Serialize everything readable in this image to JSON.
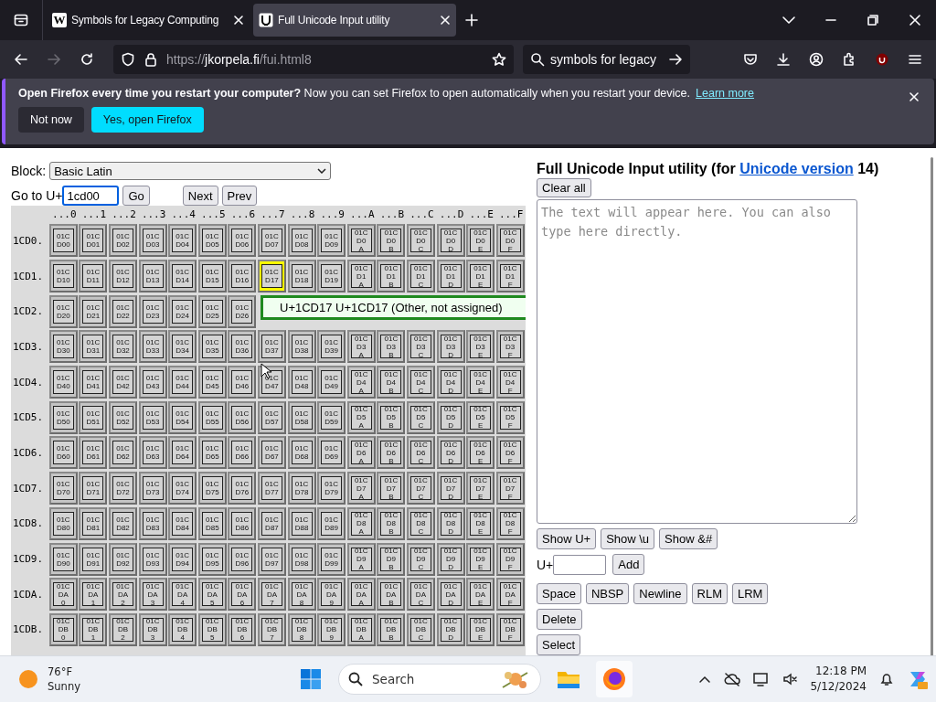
{
  "browser": {
    "tabs": [
      {
        "favicon": "W",
        "title": "Symbols for Legacy Computing",
        "selected": false
      },
      {
        "title": "Full Unicode Input utility",
        "selected": true
      }
    ],
    "address": {
      "scheme": "https://",
      "host": "jkorpela.fi",
      "path": "/fui.html8"
    },
    "search": {
      "value": "symbols for legacy"
    },
    "notification": {
      "message": "**Open Firefox every time you restart your computer?** Now you can set Firefox to open automatically when you restart your device.",
      "link": "Learn more",
      "buttons": [
        "Not now",
        "Yes, open Firefox"
      ]
    }
  },
  "page": {
    "block": {
      "label": "Block:",
      "value": "Basic Latin"
    },
    "goto": {
      "label": "Go to U+",
      "value": "1cd00",
      "go": "Go",
      "nav": [
        "Next",
        "Prev"
      ]
    },
    "grid": {
      "columns": [
        "...0",
        "...1",
        "...2",
        "...3",
        "...4",
        "...5",
        "...6",
        "...7",
        "...8",
        "...9",
        "...A",
        "...B",
        "...C",
        "...D",
        "...E",
        "...F"
      ],
      "rows": [
        {
          "label": "1CD0.",
          "cells": [
            {
              "code": "01CD00",
              "selected": false
            },
            {
              "code": "01CD01",
              "selected": false
            },
            {
              "code": "01CD02",
              "selected": false
            },
            {
              "code": "01CD03",
              "selected": false
            },
            {
              "code": "01CD04",
              "selected": false
            },
            {
              "code": "01CD05",
              "selected": false
            },
            {
              "code": "01CD06",
              "selected": false
            },
            {
              "code": "01CD07",
              "selected": false
            },
            {
              "code": "01CD08",
              "selected": false
            },
            {
              "code": "01CD09",
              "selected": false
            },
            {
              "code": "01CD0A",
              "selected": false
            },
            {
              "code": "01CD0B",
              "selected": false
            },
            {
              "code": "01CD0C",
              "selected": false
            },
            {
              "code": "01CD0D",
              "selected": false
            },
            {
              "code": "01CD0E",
              "selected": false
            },
            {
              "code": "01CD0F",
              "selected": false
            }
          ]
        },
        {
          "label": "1CD1.",
          "cells": [
            {
              "code": "01CD10",
              "selected": false
            },
            {
              "code": "01CD11",
              "selected": false
            },
            {
              "code": "01CD12",
              "selected": false
            },
            {
              "code": "01CD13",
              "selected": false
            },
            {
              "code": "01CD14",
              "selected": false
            },
            {
              "code": "01CD15",
              "selected": false
            },
            {
              "code": "01CD16",
              "selected": false
            },
            {
              "code": "01CD17",
              "selected": true
            },
            {
              "code": "01CD18",
              "selected": false
            },
            {
              "code": "01CD19",
              "selected": false
            },
            {
              "code": "01CD1A",
              "selected": false
            },
            {
              "code": "01CD1B",
              "selected": false
            },
            {
              "code": "01CD1C",
              "selected": false
            },
            {
              "code": "01CD1D",
              "selected": false
            },
            {
              "code": "01CD1E",
              "selected": false
            },
            {
              "code": "01CD1F",
              "selected": false
            }
          ]
        },
        {
          "label": "1CD2.",
          "cells": [
            {
              "code": "01CD20",
              "selected": false
            },
            {
              "code": "01CD21",
              "selected": false
            },
            {
              "code": "01CD22",
              "selected": false
            },
            {
              "code": "01CD23",
              "selected": false
            },
            {
              "code": "01CD24",
              "selected": false
            },
            {
              "code": "01CD25",
              "selected": false
            },
            {
              "code": "01CD26",
              "selected": false
            }
          ]
        },
        {
          "label": "1CD3.",
          "cells": [
            {
              "code": "01CD30",
              "selected": false
            },
            {
              "code": "01CD31",
              "selected": false
            },
            {
              "code": "01CD32",
              "selected": false
            },
            {
              "code": "01CD33",
              "selected": false
            },
            {
              "code": "01CD34",
              "selected": false
            },
            {
              "code": "01CD35",
              "selected": false
            },
            {
              "code": "01CD36",
              "selected": false
            },
            {
              "code": "01CD37",
              "selected": false
            },
            {
              "code": "01CD38",
              "selected": false
            },
            {
              "code": "01CD39",
              "selected": false
            },
            {
              "code": "01CD3A",
              "selected": false
            },
            {
              "code": "01CD3B",
              "selected": false
            },
            {
              "code": "01CD3C",
              "selected": false
            },
            {
              "code": "01CD3D",
              "selected": false
            },
            {
              "code": "01CD3E",
              "selected": false
            },
            {
              "code": "01CD3F",
              "selected": false
            }
          ]
        },
        {
          "label": "1CD4.",
          "cells": [
            {
              "code": "01CD40",
              "selected": false
            },
            {
              "code": "01CD41",
              "selected": false
            },
            {
              "code": "01CD42",
              "selected": false
            },
            {
              "code": "01CD43",
              "selected": false
            },
            {
              "code": "01CD44",
              "selected": false
            },
            {
              "code": "01CD45",
              "selected": false
            },
            {
              "code": "01CD46",
              "selected": false
            },
            {
              "code": "01CD47",
              "selected": false
            },
            {
              "code": "01CD48",
              "selected": false
            },
            {
              "code": "01CD49",
              "selected": false
            },
            {
              "code": "01CD4A",
              "selected": false
            },
            {
              "code": "01CD4B",
              "selected": false
            },
            {
              "code": "01CD4C",
              "selected": false
            },
            {
              "code": "01CD4D",
              "selected": false
            },
            {
              "code": "01CD4E",
              "selected": false
            },
            {
              "code": "01CD4F",
              "selected": false
            }
          ]
        },
        {
          "label": "1CD5.",
          "cells": [
            {
              "code": "01CD50",
              "selected": false
            },
            {
              "code": "01CD51",
              "selected": false
            },
            {
              "code": "01CD52",
              "selected": false
            },
            {
              "code": "01CD53",
              "selected": false
            },
            {
              "code": "01CD54",
              "selected": false
            },
            {
              "code": "01CD55",
              "selected": false
            },
            {
              "code": "01CD56",
              "selected": false
            },
            {
              "code": "01CD57",
              "selected": false
            },
            {
              "code": "01CD58",
              "selected": false
            },
            {
              "code": "01CD59",
              "selected": false
            },
            {
              "code": "01CD5A",
              "selected": false
            },
            {
              "code": "01CD5B",
              "selected": false
            },
            {
              "code": "01CD5C",
              "selected": false
            },
            {
              "code": "01CD5D",
              "selected": false
            },
            {
              "code": "01CD5E",
              "selected": false
            },
            {
              "code": "01CD5F",
              "selected": false
            }
          ]
        },
        {
          "label": "1CD6.",
          "cells": [
            {
              "code": "01CD60",
              "selected": false
            },
            {
              "code": "01CD61",
              "selected": false
            },
            {
              "code": "01CD62",
              "selected": false
            },
            {
              "code": "01CD63",
              "selected": false
            },
            {
              "code": "01CD64",
              "selected": false
            },
            {
              "code": "01CD65",
              "selected": false
            },
            {
              "code": "01CD66",
              "selected": false
            },
            {
              "code": "01CD67",
              "selected": false
            },
            {
              "code": "01CD68",
              "selected": false
            },
            {
              "code": "01CD69",
              "selected": false
            },
            {
              "code": "01CD6A",
              "selected": false
            },
            {
              "code": "01CD6B",
              "selected": false
            },
            {
              "code": "01CD6C",
              "selected": false
            },
            {
              "code": "01CD6D",
              "selected": false
            },
            {
              "code": "01CD6E",
              "selected": false
            },
            {
              "code": "01CD6F",
              "selected": false
            }
          ]
        },
        {
          "label": "1CD7.",
          "cells": [
            {
              "code": "01CD70",
              "selected": false
            },
            {
              "code": "01CD71",
              "selected": false
            },
            {
              "code": "01CD72",
              "selected": false
            },
            {
              "code": "01CD73",
              "selected": false
            },
            {
              "code": "01CD74",
              "selected": false
            },
            {
              "code": "01CD75",
              "selected": false
            },
            {
              "code": "01CD76",
              "selected": false
            },
            {
              "code": "01CD77",
              "selected": false
            },
            {
              "code": "01CD78",
              "selected": false
            },
            {
              "code": "01CD79",
              "selected": false
            },
            {
              "code": "01CD7A",
              "selected": false
            },
            {
              "code": "01CD7B",
              "selected": false
            },
            {
              "code": "01CD7C",
              "selected": false
            },
            {
              "code": "01CD7D",
              "selected": false
            },
            {
              "code": "01CD7E",
              "selected": false
            },
            {
              "code": "01CD7F",
              "selected": false
            }
          ]
        },
        {
          "label": "1CD8.",
          "cells": [
            {
              "code": "01CD80",
              "selected": false
            },
            {
              "code": "01CD81",
              "selected": false
            },
            {
              "code": "01CD82",
              "selected": false
            },
            {
              "code": "01CD83",
              "selected": false
            },
            {
              "code": "01CD84",
              "selected": false
            },
            {
              "code": "01CD85",
              "selected": false
            },
            {
              "code": "01CD86",
              "selected": false
            },
            {
              "code": "01CD87",
              "selected": false
            },
            {
              "code": "01CD88",
              "selected": false
            },
            {
              "code": "01CD89",
              "selected": false
            },
            {
              "code": "01CD8A",
              "selected": false
            },
            {
              "code": "01CD8B",
              "selected": false
            },
            {
              "code": "01CD8C",
              "selected": false
            },
            {
              "code": "01CD8D",
              "selected": false
            },
            {
              "code": "01CD8E",
              "selected": false
            },
            {
              "code": "01CD8F",
              "selected": false
            }
          ]
        },
        {
          "label": "1CD9.",
          "cells": [
            {
              "code": "01CD90",
              "selected": false
            },
            {
              "code": "01CD91",
              "selected": false
            },
            {
              "code": "01CD92",
              "selected": false
            },
            {
              "code": "01CD93",
              "selected": false
            },
            {
              "code": "01CD94",
              "selected": false
            },
            {
              "code": "01CD95",
              "selected": false
            },
            {
              "code": "01CD96",
              "selected": false
            },
            {
              "code": "01CD97",
              "selected": false
            },
            {
              "code": "01CD98",
              "selected": false
            },
            {
              "code": "01CD99",
              "selected": false
            },
            {
              "code": "01CD9A",
              "selected": false
            },
            {
              "code": "01CD9B",
              "selected": false
            },
            {
              "code": "01CD9C",
              "selected": false
            },
            {
              "code": "01CD9D",
              "selected": false
            },
            {
              "code": "01CD9E",
              "selected": false
            },
            {
              "code": "01CD9F",
              "selected": false
            }
          ]
        },
        {
          "label": "1CDA.",
          "cells": [
            {
              "code": "01CDA0",
              "selected": false
            },
            {
              "code": "01CDA1",
              "selected": false
            },
            {
              "code": "01CDA2",
              "selected": false
            },
            {
              "code": "01CDA3",
              "selected": false
            },
            {
              "code": "01CDA4",
              "selected": false
            },
            {
              "code": "01CDA5",
              "selected": false
            },
            {
              "code": "01CDA6",
              "selected": false
            },
            {
              "code": "01CDA7",
              "selected": false
            },
            {
              "code": "01CDA8",
              "selected": false
            },
            {
              "code": "01CDA9",
              "selected": false
            },
            {
              "code": "01CDAA",
              "selected": false
            },
            {
              "code": "01CDAB",
              "selected": false
            },
            {
              "code": "01CDAC",
              "selected": false
            },
            {
              "code": "01CDAD",
              "selected": false
            },
            {
              "code": "01CDAE",
              "selected": false
            },
            {
              "code": "01CDAF",
              "selected": false
            }
          ]
        },
        {
          "label": "1CDB.",
          "cells": [
            {
              "code": "01CDB0",
              "selected": false
            },
            {
              "code": "01CDB1",
              "selected": false
            },
            {
              "code": "01CDB2",
              "selected": false
            },
            {
              "code": "01CDB3",
              "selected": false
            },
            {
              "code": "01CDB4",
              "selected": false
            },
            {
              "code": "01CDB5",
              "selected": false
            },
            {
              "code": "01CDB6",
              "selected": false
            },
            {
              "code": "01CDB7",
              "selected": false
            },
            {
              "code": "01CDB8",
              "selected": false
            },
            {
              "code": "01CDB9",
              "selected": false
            },
            {
              "code": "01CDBA",
              "selected": false
            },
            {
              "code": "01CDBB",
              "selected": false
            },
            {
              "code": "01CDBC",
              "selected": false
            },
            {
              "code": "01CDBD",
              "selected": false
            },
            {
              "code": "01CDBE",
              "selected": false
            },
            {
              "code": "01CDBF",
              "selected": false
            }
          ]
        }
      ]
    },
    "tooltip": "U+1CD17 U+1CD17 (Other, not assigned)",
    "title": {
      "before": "Full Unicode Input utility (for ",
      "link": "Unicode version",
      "after": " 14)"
    },
    "clear": "Clear all",
    "textarea": {
      "placeholder": "The text will appear here. You can also type here directly."
    },
    "show_buttons": [
      "Show U+",
      "Show \\u",
      "Show &#"
    ],
    "add": {
      "label": "U+",
      "button": "Add"
    },
    "insert_buttons": [
      "Space",
      "NBSP",
      "Newline",
      "RLM",
      "LRM"
    ],
    "more_buttons": [
      "Delete",
      "Select"
    ]
  },
  "taskbar": {
    "weather": {
      "temp": "76°F",
      "condition": "Sunny"
    },
    "search": {
      "placeholder": "Search"
    },
    "clock": {
      "time": "12:18 PM",
      "date": "5/12/2024"
    }
  }
}
